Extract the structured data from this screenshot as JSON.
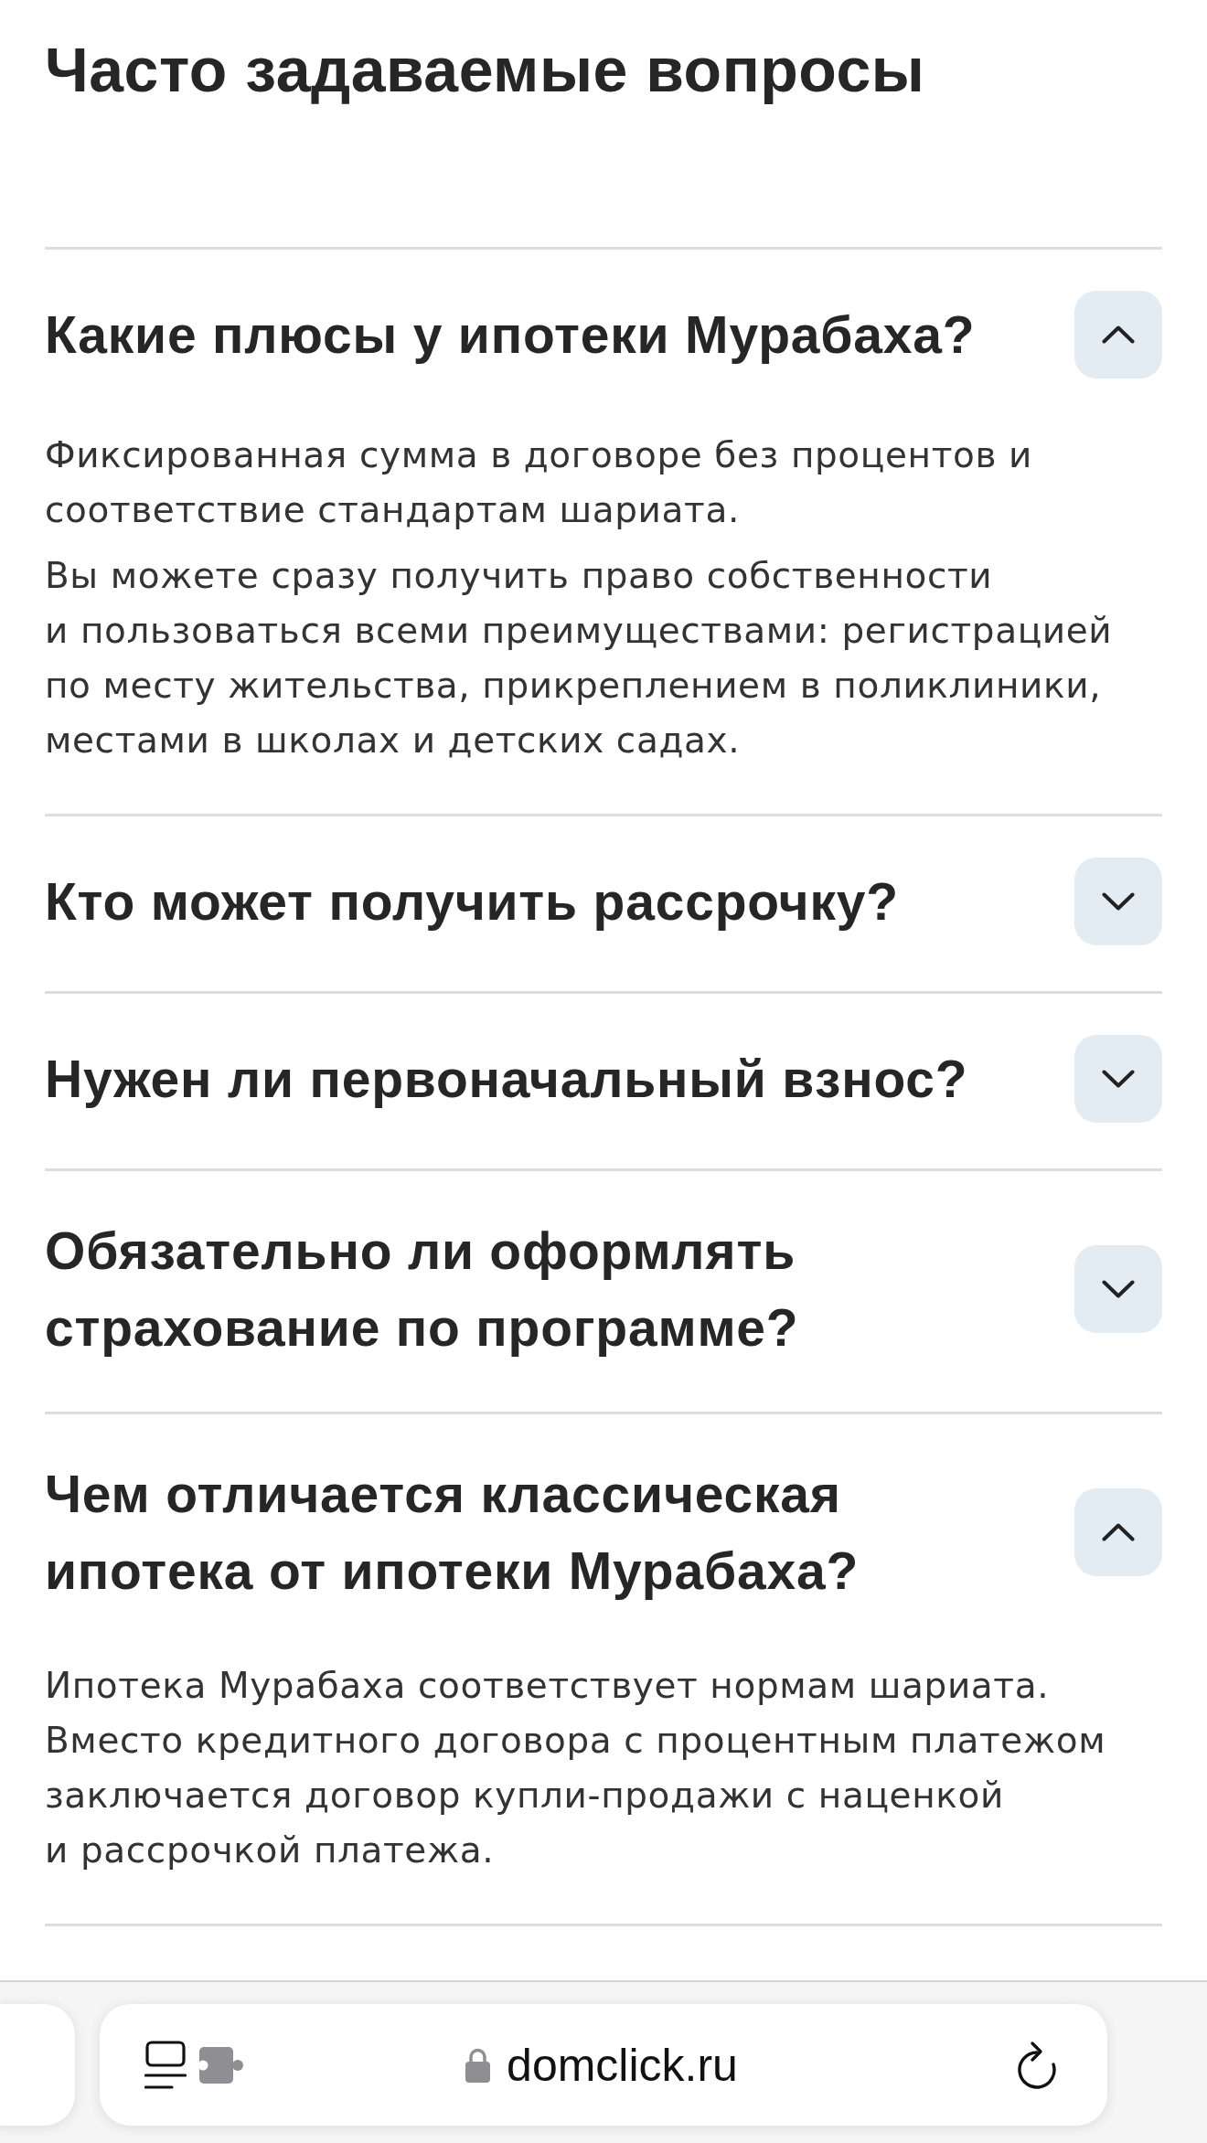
{
  "title": "Часто задаваемые вопросы",
  "faq": [
    {
      "question": "Какие плюсы у ипотеки Мурабаха?",
      "expanded": true,
      "answer": [
        "Фиксированная сумма в договоре без процентов и соответствие стандартам шариата.",
        "Вы можете сразу получить право собственности и пользоваться всеми преимуществами: регистрацией по месту жительства, прикреплением в поликлиники, местами в школах и детских садах."
      ]
    },
    {
      "question": "Кто может получить рассрочку?",
      "expanded": false
    },
    {
      "question": "Нужен ли первоначальный взнос?",
      "expanded": false
    },
    {
      "question": "Обязательно ли оформлять страхование по программе?",
      "expanded": false
    },
    {
      "question": "Чем отличается классическая ипотека от ипотеки Мурабаха?",
      "expanded": true,
      "answer": [
        "Ипотека Мурабаха соответствует нормам шариата. Вместо кредитного договора с процентным платежом заключается договор купли-продажи с наценкой и рассрочкой платежа."
      ]
    }
  ],
  "browser_toolbar": {
    "url": "domclick.ru"
  }
}
